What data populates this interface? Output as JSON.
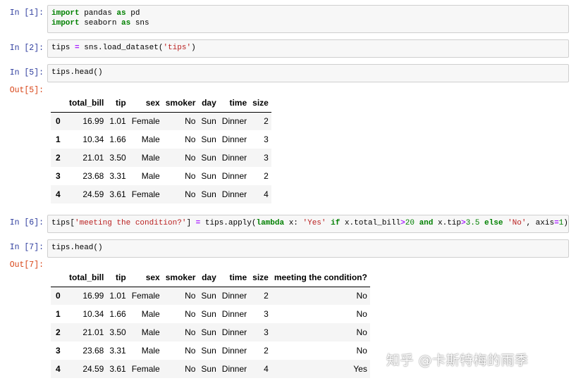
{
  "cells": [
    {
      "prompt": "In  [1]:",
      "line1": {
        "k1": "import",
        "t1": " pandas ",
        "k2": "as",
        "t2": " pd"
      },
      "line2": {
        "k1": "import",
        "t1": " seaborn ",
        "k2": "as",
        "t2": " sns"
      }
    },
    {
      "prompt": "In  [2]:",
      "code": {
        "a": "tips ",
        "eq": "=",
        "b": " sns.load_dataset(",
        "s": "'tips'",
        "c": ")"
      }
    },
    {
      "prompt": "In  [5]:",
      "code": "tips.head()",
      "out_prompt": "Out[5]:"
    },
    {
      "prompt": "In  [6]:",
      "code": {
        "a": "tips[",
        "s1": "'meeting the condition?'",
        "b": "] ",
        "eq": "=",
        "c": " tips.apply(",
        "k1": "lambda",
        "d": " x: ",
        "s2": "'Yes'",
        "e": " ",
        "k2": "if",
        "f": " x.total_bill",
        "gt1": ">",
        "n1": "20",
        "g": " ",
        "k3": "and",
        "h": " x.tip",
        "gt2": ">",
        "n2": "3.5",
        "i": " ",
        "k4": "else",
        "j": " ",
        "s3": "'No'",
        "k": ", axis",
        "eq2": "=",
        "n3": "1",
        "l": ")"
      }
    },
    {
      "prompt": "In  [7]:",
      "code": "tips.head()",
      "out_prompt": "Out[7]:"
    }
  ],
  "table1": {
    "columns": [
      "total_bill",
      "tip",
      "sex",
      "smoker",
      "day",
      "time",
      "size"
    ],
    "rows": [
      {
        "index": "0",
        "values": [
          "16.99",
          "1.01",
          "Female",
          "No",
          "Sun",
          "Dinner",
          "2"
        ]
      },
      {
        "index": "1",
        "values": [
          "10.34",
          "1.66",
          "Male",
          "No",
          "Sun",
          "Dinner",
          "3"
        ]
      },
      {
        "index": "2",
        "values": [
          "21.01",
          "3.50",
          "Male",
          "No",
          "Sun",
          "Dinner",
          "3"
        ]
      },
      {
        "index": "3",
        "values": [
          "23.68",
          "3.31",
          "Male",
          "No",
          "Sun",
          "Dinner",
          "2"
        ]
      },
      {
        "index": "4",
        "values": [
          "24.59",
          "3.61",
          "Female",
          "No",
          "Sun",
          "Dinner",
          "4"
        ]
      }
    ]
  },
  "table2": {
    "columns": [
      "total_bill",
      "tip",
      "sex",
      "smoker",
      "day",
      "time",
      "size",
      "meeting the condition?"
    ],
    "rows": [
      {
        "index": "0",
        "values": [
          "16.99",
          "1.01",
          "Female",
          "No",
          "Sun",
          "Dinner",
          "2",
          "No"
        ]
      },
      {
        "index": "1",
        "values": [
          "10.34",
          "1.66",
          "Male",
          "No",
          "Sun",
          "Dinner",
          "3",
          "No"
        ]
      },
      {
        "index": "2",
        "values": [
          "21.01",
          "3.50",
          "Male",
          "No",
          "Sun",
          "Dinner",
          "3",
          "No"
        ]
      },
      {
        "index": "3",
        "values": [
          "23.68",
          "3.31",
          "Male",
          "No",
          "Sun",
          "Dinner",
          "2",
          "No"
        ]
      },
      {
        "index": "4",
        "values": [
          "24.59",
          "3.61",
          "Female",
          "No",
          "Sun",
          "Dinner",
          "4",
          "Yes"
        ]
      }
    ]
  },
  "watermark": "知乎 @卡斯特梅的雨季"
}
